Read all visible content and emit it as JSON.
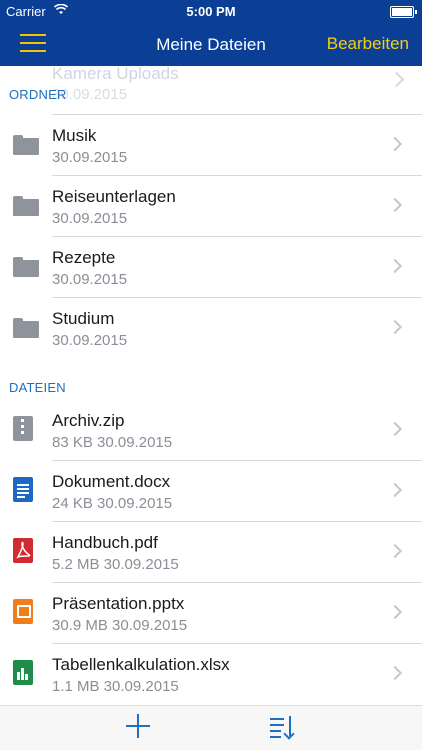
{
  "status_bar": {
    "carrier": "Carrier",
    "time": "5:00 PM"
  },
  "nav": {
    "title": "Meine Dateien",
    "edit_label": "Bearbeiten"
  },
  "ghost_row": {
    "title": "Kamera Uploads",
    "date": "30.09.2015"
  },
  "sections": {
    "folders": "ORDNER",
    "files": "DATEIEN"
  },
  "folders": [
    {
      "name": "Musik",
      "date": "30.09.2015"
    },
    {
      "name": "Reiseunterlagen",
      "date": "30.09.2015"
    },
    {
      "name": "Rezepte",
      "date": "30.09.2015"
    },
    {
      "name": "Studium",
      "date": "30.09.2015"
    }
  ],
  "files": [
    {
      "name": "Archiv.zip",
      "meta": "83 KB  30.09.2015",
      "icon": "zip-file-icon"
    },
    {
      "name": "Dokument.docx",
      "meta": "24 KB  30.09.2015",
      "icon": "word-document-icon"
    },
    {
      "name": "Handbuch.pdf",
      "meta": "5.2 MB  30.09.2015",
      "icon": "pdf-file-icon"
    },
    {
      "name": "Präsentation.pptx",
      "meta": "30.9 MB  30.09.2015",
      "icon": "presentation-file-icon"
    },
    {
      "name": "Tabellenkalkulation.xlsx",
      "meta": "1.1 MB  30.09.2015",
      "icon": "spreadsheet-file-icon"
    }
  ],
  "colors": {
    "bar": "#0b3f96",
    "accent": "#f6cd15",
    "link": "#1d6fbf"
  }
}
